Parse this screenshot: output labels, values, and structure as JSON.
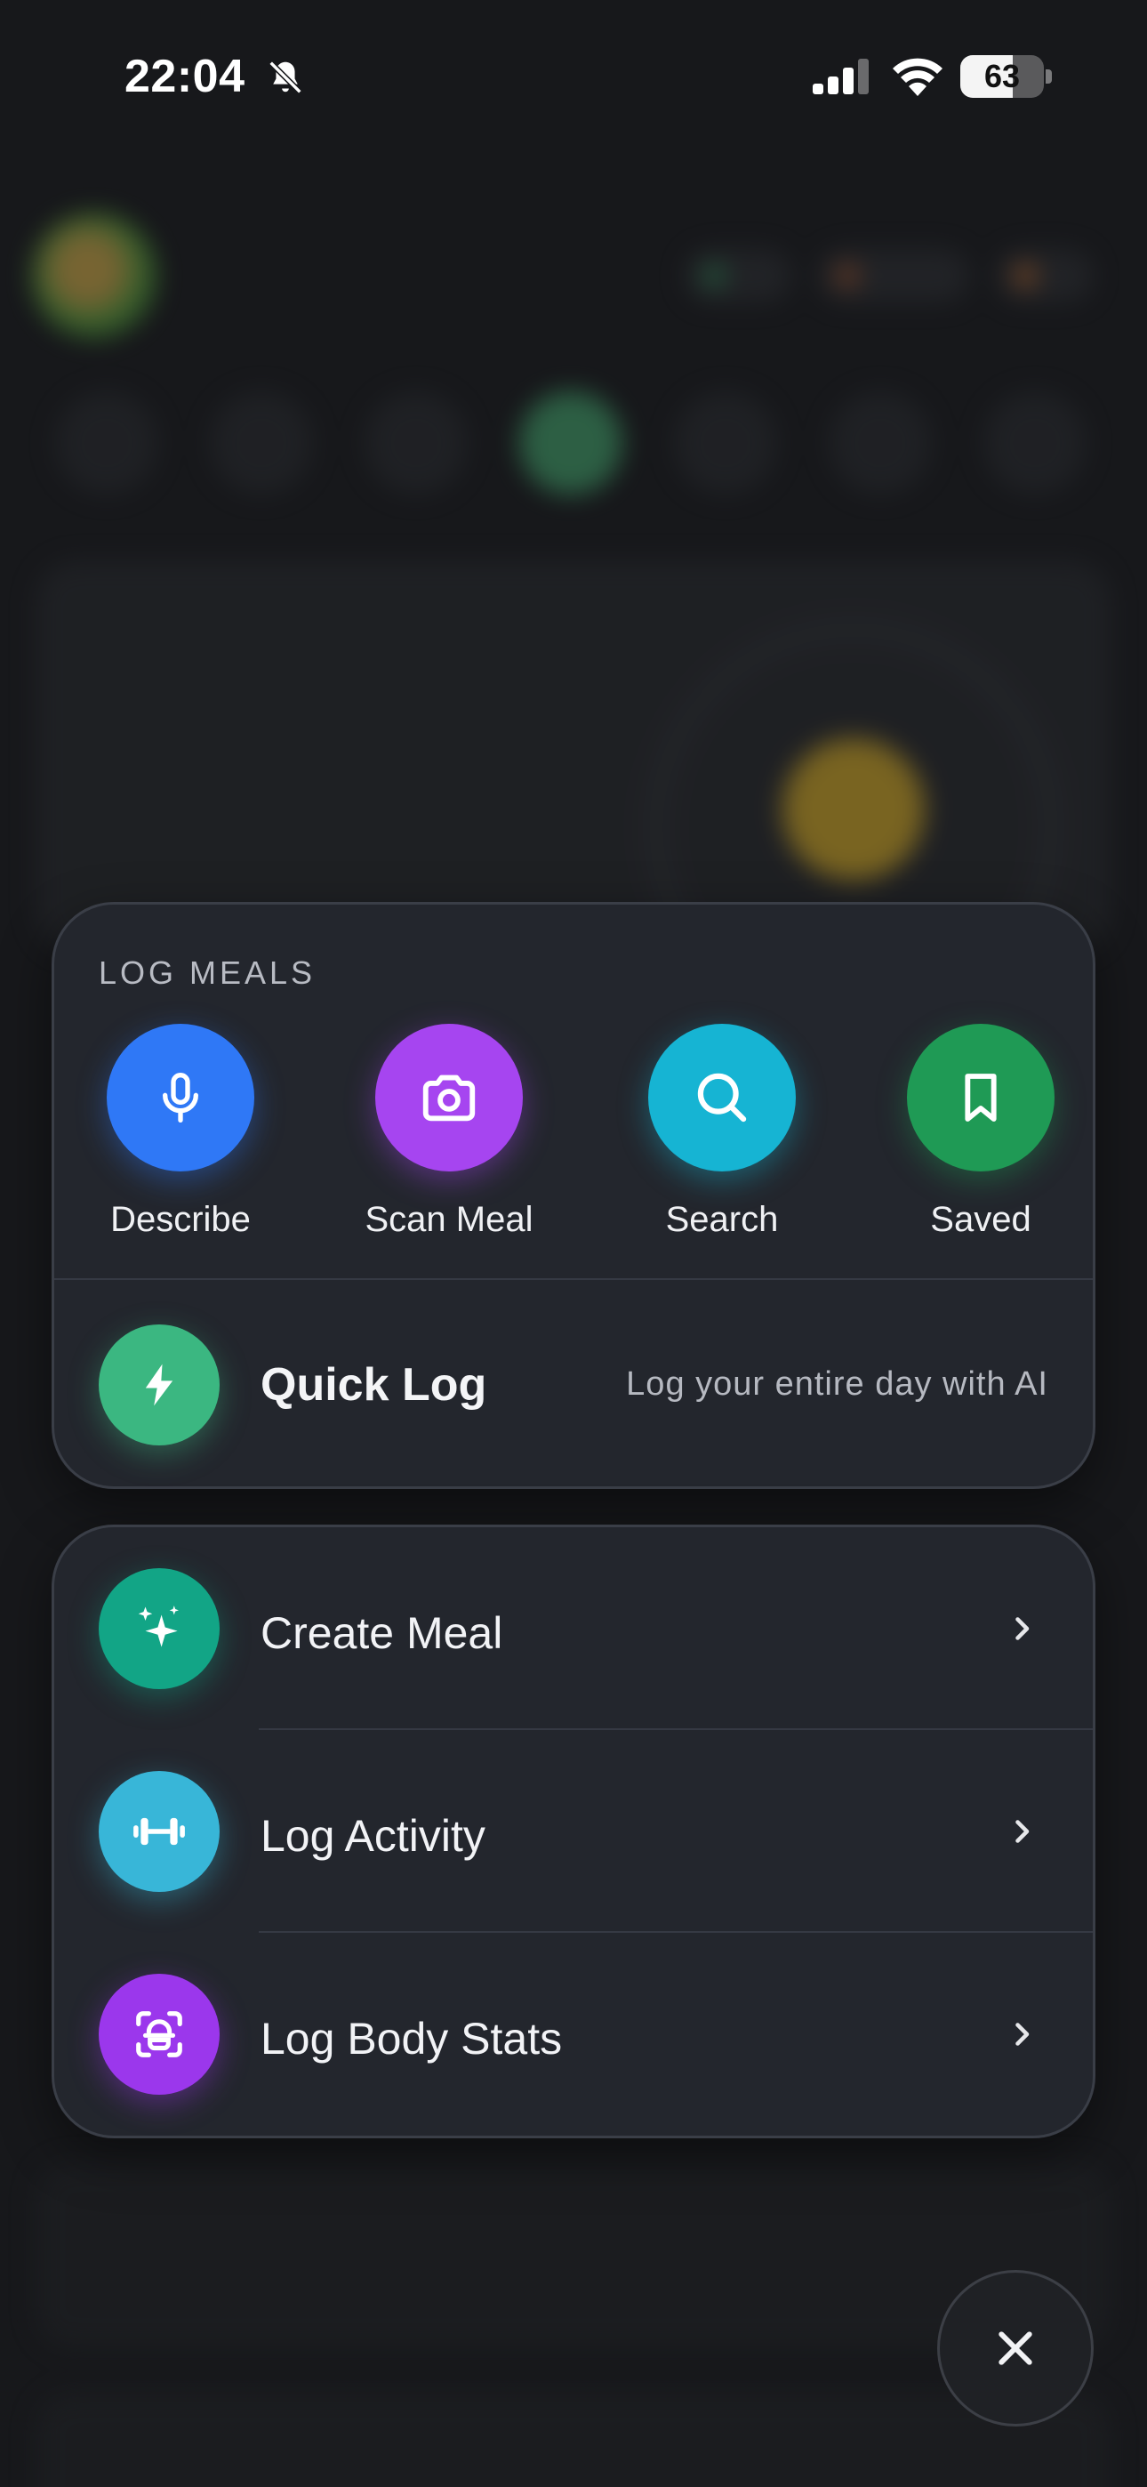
{
  "status_bar": {
    "time": "22:04",
    "battery_level": "63",
    "battery_fraction": 0.63,
    "icons": [
      "bell-slash-icon",
      "cellular-signal-icon",
      "wifi-icon",
      "battery-icon"
    ]
  },
  "log_meals": {
    "title": "LOG MEALS",
    "options": [
      {
        "label": "Describe",
        "icon": "microphone-icon",
        "color": "#2f78f6"
      },
      {
        "label": "Scan Meal",
        "icon": "camera-icon",
        "color": "#a645f0"
      },
      {
        "label": "Search",
        "icon": "search-icon",
        "color": "#16b4d3"
      },
      {
        "label": "Saved",
        "icon": "bookmark-icon",
        "color": "#1f9a55"
      }
    ],
    "quick_log": {
      "label": "Quick Log",
      "subtitle": "Log your entire day with AI",
      "icon": "lightning-icon",
      "color": "#3bb781"
    }
  },
  "actions": [
    {
      "label": "Create Meal",
      "icon": "sparkles-icon",
      "color": "#12a586"
    },
    {
      "label": "Log Activity",
      "icon": "dumbbell-icon",
      "color": "#38b6d8"
    },
    {
      "label": "Log Body Stats",
      "icon": "body-scan-icon",
      "color": "#9b37ec"
    }
  ],
  "close_icon": "close-icon",
  "colors": {
    "panel_bg": "#23262d",
    "panel_border": "#3a3e47",
    "backdrop": "#17181b"
  }
}
